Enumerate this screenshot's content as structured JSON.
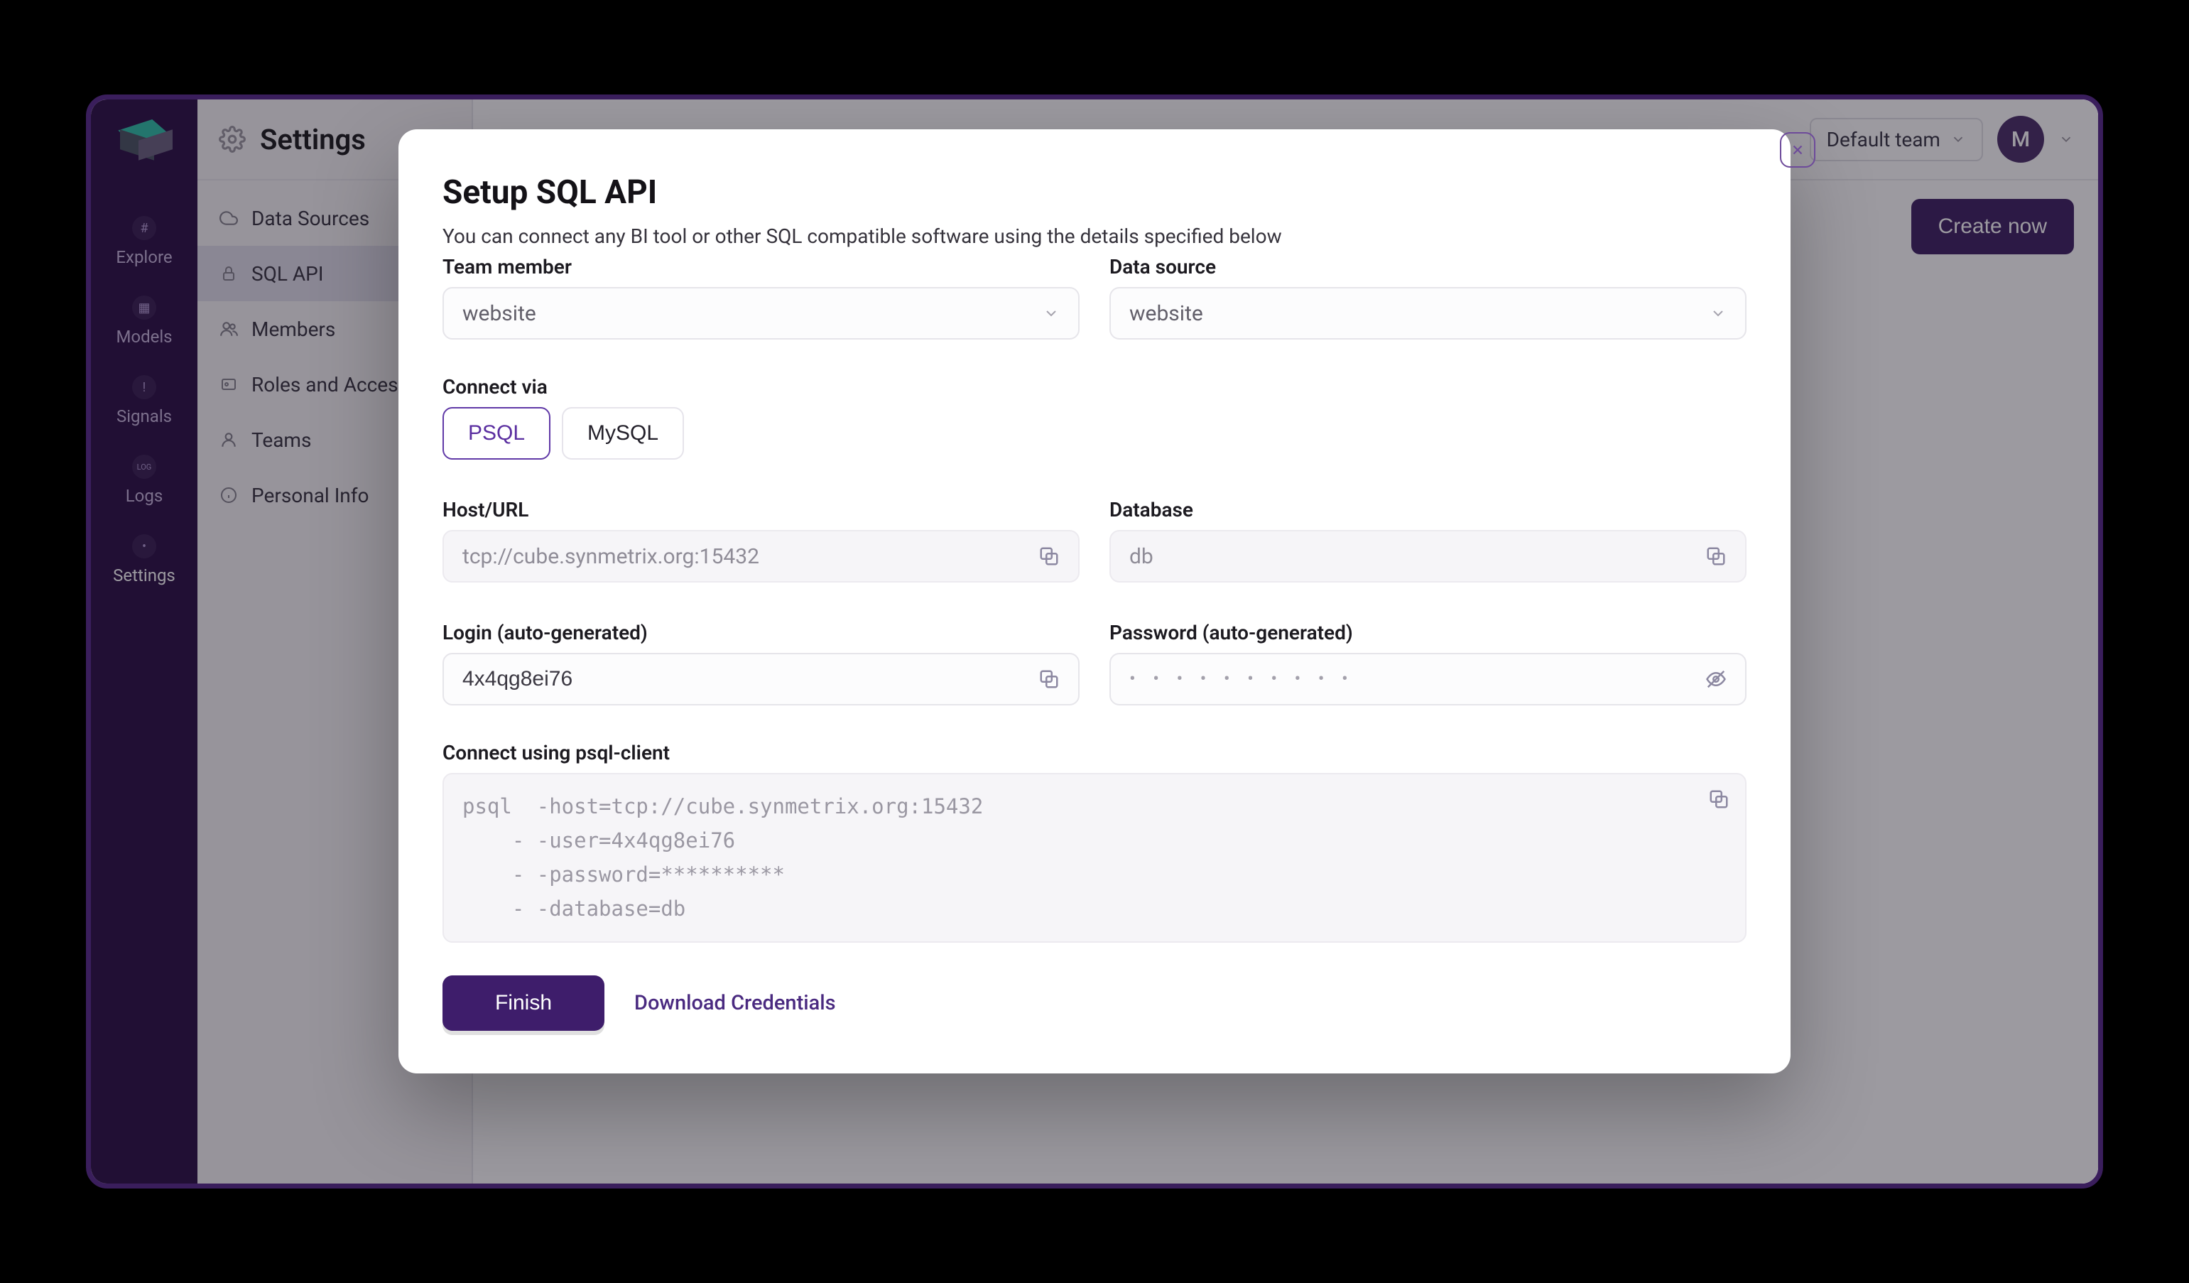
{
  "sidebar": {
    "items": [
      {
        "label": "Explore"
      },
      {
        "label": "Models"
      },
      {
        "label": "Signals"
      },
      {
        "label": "Logs"
      },
      {
        "label": "Settings"
      }
    ]
  },
  "secondary": {
    "title": "Settings",
    "items": [
      {
        "label": "Data Sources"
      },
      {
        "label": "SQL API"
      },
      {
        "label": "Members"
      },
      {
        "label": "Roles and Access"
      },
      {
        "label": "Teams"
      },
      {
        "label": "Personal Info"
      }
    ]
  },
  "topbar": {
    "team": "Default team",
    "avatar": "M"
  },
  "content": {
    "create_button": "Create now"
  },
  "modal": {
    "title": "Setup SQL API",
    "subtitle": "You can connect any BI tool or other SQL compatible software using the details specified below",
    "team_member": {
      "label": "Team member",
      "value": "website"
    },
    "data_source": {
      "label": "Data source",
      "value": "website"
    },
    "connect_via": {
      "label": "Connect via",
      "options": [
        "PSQL",
        "MySQL"
      ],
      "selected": "PSQL"
    },
    "host": {
      "label": "Host/URL",
      "value": "tcp://cube.synmetrix.org:15432"
    },
    "database": {
      "label": "Database",
      "value": "db"
    },
    "login": {
      "label": "Login (auto-generated)",
      "value": "4x4qg8ei76"
    },
    "password": {
      "label": "Password (auto-generated)",
      "mask": "• • • • • • • • • •"
    },
    "client": {
      "label": "Connect using psql-client",
      "code": "psql  -host=tcp://cube.synmetrix.org:15432\n    - -user=4x4qg8ei76\n    - -password=**********\n    - -database=db"
    },
    "finish": "Finish",
    "download": "Download Credentials"
  }
}
